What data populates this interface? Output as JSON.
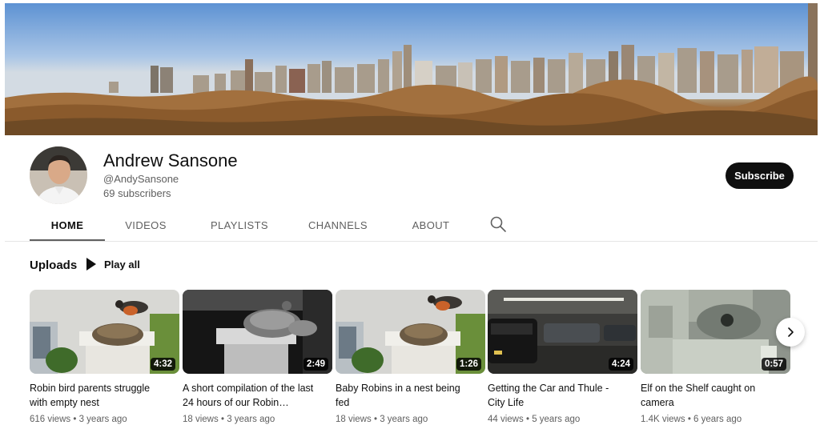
{
  "channel": {
    "name": "Andrew Sansone",
    "handle": "@AndySansone",
    "subscribers": "69 subscribers",
    "subscribe_label": "Subscribe"
  },
  "tabs": [
    {
      "label": "HOME",
      "active": true
    },
    {
      "label": "VIDEOS",
      "active": false
    },
    {
      "label": "PLAYLISTS",
      "active": false
    },
    {
      "label": "CHANNELS",
      "active": false
    },
    {
      "label": "ABOUT",
      "active": false
    }
  ],
  "search_icon": "search-icon",
  "section": {
    "title": "Uploads",
    "play_all_label": "Play all"
  },
  "videos": [
    {
      "title": "Robin bird parents struggle with empty nest",
      "duration": "4:32",
      "views": "616 views",
      "age": "3 years ago"
    },
    {
      "title": "A short compilation of the last 24 hours of our Robin…",
      "duration": "2:49",
      "views": "18 views",
      "age": "3 years ago"
    },
    {
      "title": "Baby Robins in a nest being fed",
      "duration": "1:26",
      "views": "18 views",
      "age": "3 years ago"
    },
    {
      "title": "Getting the Car and Thule - City Life",
      "duration": "4:24",
      "views": "44 views",
      "age": "5 years ago"
    },
    {
      "title": "Elf on the Shelf caught on camera",
      "duration": "0:57",
      "views": "1.4K views",
      "age": "6 years ago"
    }
  ],
  "meta_separator": "•",
  "next_icon": "chevron-right-icon",
  "colors": {
    "subscribe_bg": "#0f0f0f",
    "text_secondary": "#606060",
    "divider": "#e5e5e5"
  }
}
